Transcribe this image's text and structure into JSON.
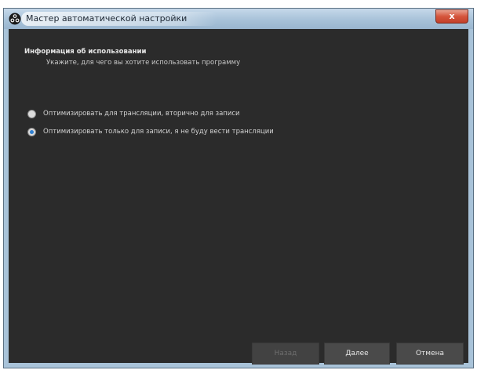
{
  "window": {
    "title": "Мастер автоматической настройки",
    "close_label": "x"
  },
  "page": {
    "section_title": "Информация об использовании",
    "section_subtitle": "Укажите, для чего вы хотите использовать программу"
  },
  "options": [
    {
      "label": "Оптимизировать для трансляции, вторично для записи",
      "selected": false
    },
    {
      "label": "Оптимизировать только для записи, я не буду вести трансляции",
      "selected": true
    }
  ],
  "buttons": {
    "back_label": "Назад",
    "next_label": "Далее",
    "cancel_label": "Отмена"
  },
  "colors": {
    "content_background": "#2b2b2b",
    "radio_accent": "#2f7fd0",
    "close_button": "#d5553c"
  },
  "icons": {
    "app": "obs-logo-icon"
  }
}
